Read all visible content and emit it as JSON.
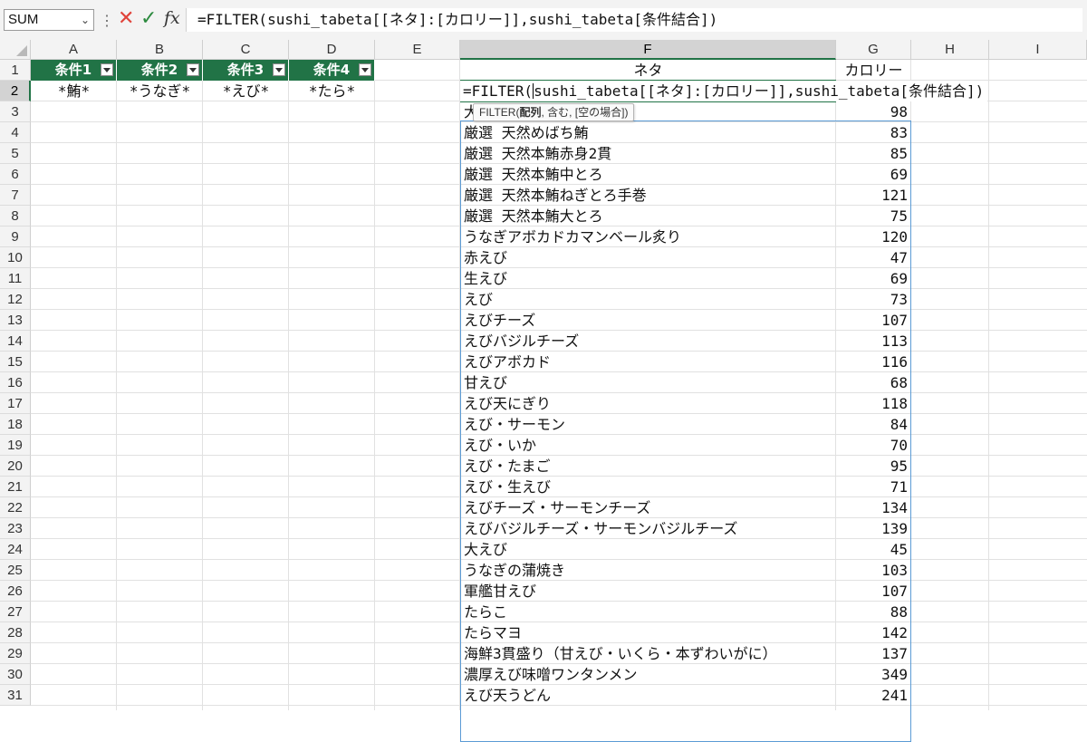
{
  "formula_bar": {
    "name_box": "SUM",
    "cancel_icon": "✕",
    "enter_icon": "✓",
    "fx_label": "fx",
    "formula": "=FILTER(sushi_tabeta[[ネタ]:[カロリー]],sushi_tabeta[条件結合])"
  },
  "columns": [
    "A",
    "B",
    "C",
    "D",
    "E",
    "F",
    "G",
    "H",
    "I"
  ],
  "rows": [
    "1",
    "2",
    "3",
    "4",
    "5",
    "6",
    "7",
    "8",
    "9",
    "10",
    "11",
    "12",
    "13",
    "14",
    "15",
    "16",
    "17",
    "18",
    "19",
    "20",
    "21",
    "22",
    "23",
    "24",
    "25",
    "26",
    "27",
    "28",
    "29",
    "30",
    "31"
  ],
  "criteria_table": {
    "headers": [
      "条件1",
      "条件2",
      "条件3",
      "条件4"
    ],
    "values": [
      "*鮪*",
      "*うなぎ*",
      "*えび*",
      "*たら*"
    ]
  },
  "result_headers": {
    "neta": "ネタ",
    "calorie": "カロリー"
  },
  "editing": {
    "prefix": "=FILTER(",
    "rest": "sushi_tabeta[[ネタ]:[カロリー]],sushi_tabeta[条件結合])",
    "tooltip_func": "FILTER(",
    "tooltip_arg1": "配列",
    "tooltip_rest": ", 含む, [空の場合])",
    "row3_hidden_first_char": "大"
  },
  "results": [
    {
      "neta": "大",
      "cal": "98"
    },
    {
      "neta": "厳選 天然めばち鮪",
      "cal": "83"
    },
    {
      "neta": "厳選 天然本鮪赤身2貫",
      "cal": "85"
    },
    {
      "neta": "厳選 天然本鮪中とろ",
      "cal": "69"
    },
    {
      "neta": "厳選 天然本鮪ねぎとろ手巻",
      "cal": "121"
    },
    {
      "neta": "厳選 天然本鮪大とろ",
      "cal": "75"
    },
    {
      "neta": "うなぎアボカドカマンベール炙り",
      "cal": "120"
    },
    {
      "neta": "赤えび",
      "cal": "47"
    },
    {
      "neta": "生えび",
      "cal": "69"
    },
    {
      "neta": "えび",
      "cal": "73"
    },
    {
      "neta": "えびチーズ",
      "cal": "107"
    },
    {
      "neta": "えびバジルチーズ",
      "cal": "113"
    },
    {
      "neta": "えびアボカド",
      "cal": "116"
    },
    {
      "neta": "甘えび",
      "cal": "68"
    },
    {
      "neta": "えび天にぎり",
      "cal": "118"
    },
    {
      "neta": "えび・サーモン",
      "cal": "84"
    },
    {
      "neta": "えび・いか",
      "cal": "70"
    },
    {
      "neta": "えび・たまご",
      "cal": "95"
    },
    {
      "neta": "えび・生えび",
      "cal": "71"
    },
    {
      "neta": "えびチーズ・サーモンチーズ",
      "cal": "134"
    },
    {
      "neta": "えびバジルチーズ・サーモンバジルチーズ",
      "cal": "139"
    },
    {
      "neta": "大えび",
      "cal": "45"
    },
    {
      "neta": "うなぎの蒲焼き",
      "cal": "103"
    },
    {
      "neta": "軍艦甘えび",
      "cal": "107"
    },
    {
      "neta": "たらこ",
      "cal": "88"
    },
    {
      "neta": "たらマヨ",
      "cal": "142"
    },
    {
      "neta": "海鮮3貫盛り（甘えび・いくら・本ずわいがに）",
      "cal": "137"
    },
    {
      "neta": "濃厚えび味噌ワンタンメン",
      "cal": "349"
    },
    {
      "neta": "えび天うどん",
      "cal": "241"
    }
  ]
}
